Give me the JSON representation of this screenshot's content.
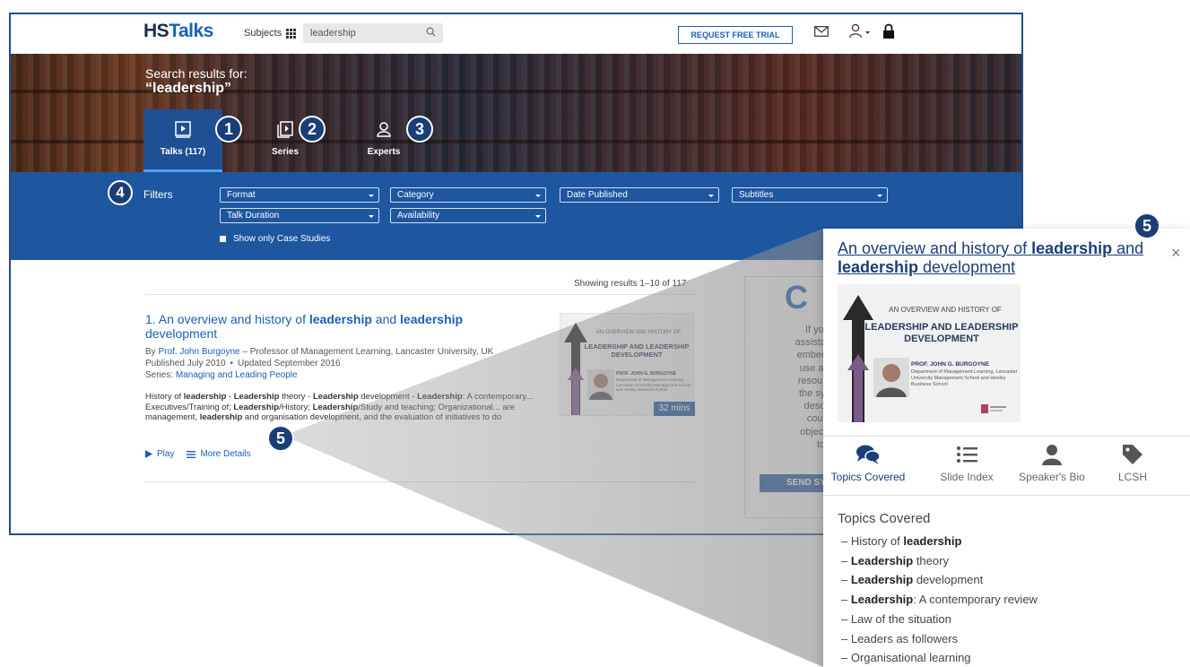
{
  "header": {
    "logo_hs": "HS",
    "logo_talks": "Talks",
    "subjects_label": "Subjects",
    "search_value": "leadership",
    "trial_button": "REQUEST FREE TRIAL"
  },
  "hero": {
    "search_label": "Search results for:",
    "query": "“leadership”",
    "tabs": [
      {
        "label": "Talks (117)",
        "active": true
      },
      {
        "label": "Series",
        "active": false
      },
      {
        "label": "Experts",
        "active": false
      }
    ]
  },
  "filters": {
    "label": "Filters",
    "dropdowns": [
      "Format",
      "Category",
      "Date Published",
      "Subtitles",
      "Talk Duration",
      "Availability"
    ],
    "case_studies": "Show only Case Studies"
  },
  "results": {
    "count": "Showing results 1–10 of 117",
    "item": {
      "title_pre": "1. An overview and history of ",
      "title_k1": "leadership",
      "title_mid": " and ",
      "title_k2": "leadership",
      "title_post": " development",
      "by_label": "By ",
      "author": "Prof. John Burgoyne",
      "affiliation": " – Professor of Management Learning, Lancaster University, UK",
      "published": "Published July 2010",
      "updated": "Updated September 2016",
      "series_label": "Series: ",
      "series": "Managing and Leading People",
      "desc": [
        {
          "t": "History of ",
          "b": false
        },
        {
          "t": "leadership",
          "b": true
        },
        {
          "t": " - ",
          "b": false
        },
        {
          "t": "Leadership",
          "b": true
        },
        {
          "t": " theory - ",
          "b": false
        },
        {
          "t": "Leadership",
          "b": true
        },
        {
          "t": " development - ",
          "b": false
        },
        {
          "t": "Leadership",
          "b": true
        },
        {
          "t": ": A contemporary... Executives/Training of; ",
          "b": false
        },
        {
          "t": "Leadership",
          "b": true
        },
        {
          "t": "/History; ",
          "b": false
        },
        {
          "t": "Leadership",
          "b": true
        },
        {
          "t": "/Study and teaching; Organizational... are management, ",
          "b": false
        },
        {
          "t": "leadership",
          "b": true
        },
        {
          "t": " and organisation development, and the evaluation of initiatives to do",
          "b": false
        }
      ],
      "play": "Play",
      "more": "More Details",
      "duration": "32 mins",
      "thumb": {
        "top": "AN OVERVIEW AND HISTORY OF",
        "title": "LEADERSHIP AND LEADERSHIP DEVELOPMENT",
        "speaker": "PROF. JOHN G. BURGOYNE",
        "affil": "Department of Management Learning, Lancaster University Management School and Henley Business School"
      }
    }
  },
  "sidebar": {
    "big_letter": "C",
    "text_lines": [
      "If you wo",
      "assistance fin",
      "embed in a c",
      "use as an a",
      "resource ple",
      "the syllabus",
      "descriptio",
      "course's",
      "objectives - ",
      "to h"
    ],
    "button": "SEND SY"
  },
  "callouts": [
    "1",
    "2",
    "3",
    "4",
    "5",
    "5"
  ],
  "panel": {
    "title_pre": "An overview and history of ",
    "title_k1": "leadership",
    "title_mid": " and ",
    "title_k2": "leadership",
    "title_post": " development",
    "close": "×",
    "tabs": [
      "Topics Covered",
      "Slide Index",
      "Speaker's Bio",
      "LCSH"
    ],
    "topics_heading": "Topics Covered",
    "topics": [
      [
        {
          "t": "– History of ",
          "b": false
        },
        {
          "t": "leadership",
          "b": true
        }
      ],
      [
        {
          "t": "– ",
          "b": false
        },
        {
          "t": "Leadership",
          "b": true
        },
        {
          "t": " theory",
          "b": false
        }
      ],
      [
        {
          "t": "– ",
          "b": false
        },
        {
          "t": "Leadership",
          "b": true
        },
        {
          "t": " development",
          "b": false
        }
      ],
      [
        {
          "t": "– ",
          "b": false
        },
        {
          "t": "Leadership",
          "b": true
        },
        {
          "t": ": A contemporary review",
          "b": false
        }
      ],
      [
        {
          "t": "– Law of the situation",
          "b": false
        }
      ],
      [
        {
          "t": "– Leaders as followers",
          "b": false
        }
      ],
      [
        {
          "t": "– Organisational learning",
          "b": false
        }
      ]
    ]
  },
  "colors": {
    "brand_blue": "#1e56a0",
    "link_blue": "#1a5fb4",
    "badge": "#1a3f78"
  }
}
